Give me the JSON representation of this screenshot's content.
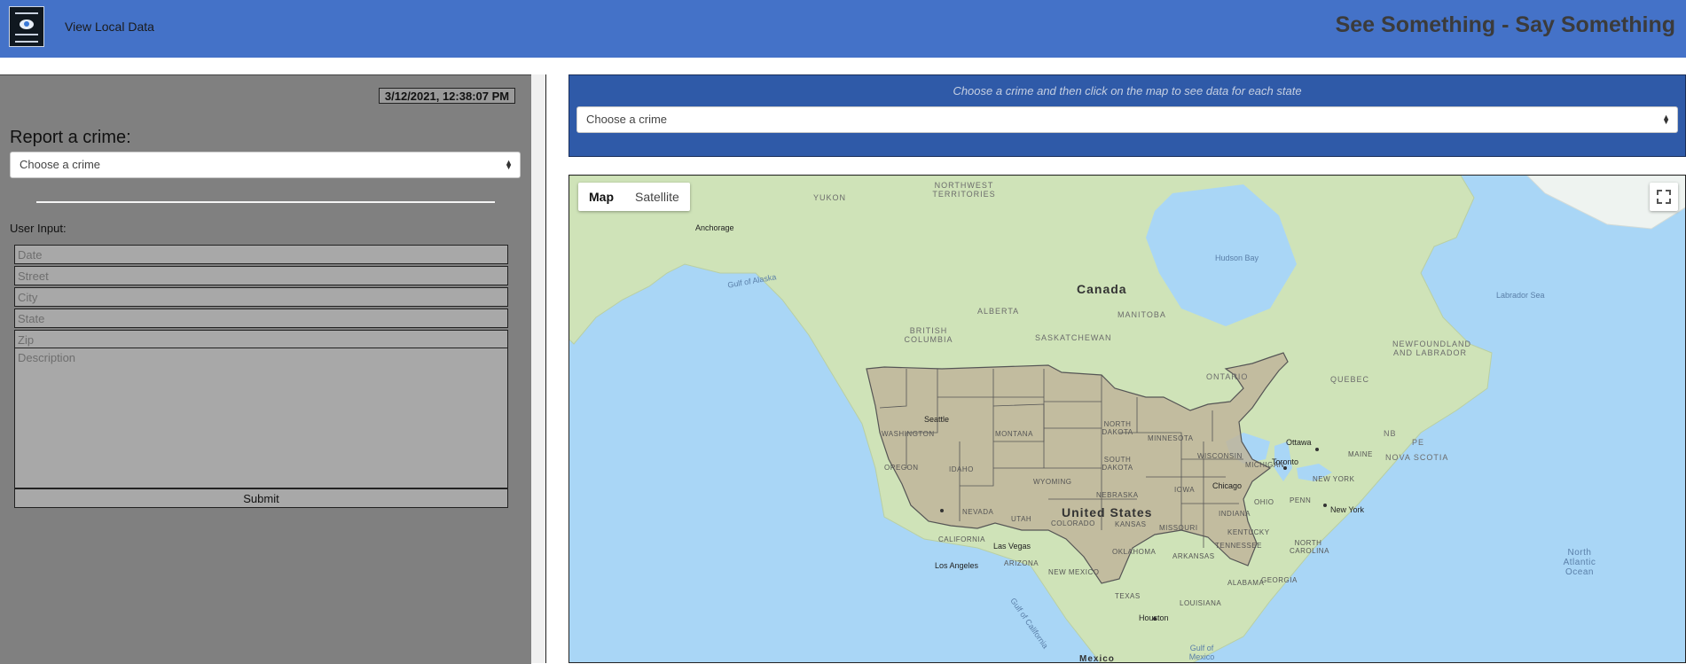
{
  "navbar": {
    "link_view_local": "View Local Data",
    "brand": "See Something - Say Something"
  },
  "report": {
    "timestamp": "3/12/2021, 12:38:07 PM",
    "title": "Report a crime:",
    "crime_select": "Choose a crime",
    "user_input_label": "User Input:",
    "placeholders": {
      "date": "Date",
      "street": "Street",
      "city": "City",
      "state": "State",
      "zip": "Zip",
      "description": "Description"
    },
    "submit_label": "Submit"
  },
  "filter": {
    "hint": "Choose a crime and then click on the map to see data for each state",
    "crime_select": "Choose a crime"
  },
  "map": {
    "type_buttons": [
      "Map",
      "Satellite"
    ],
    "active_type": "Map",
    "labels": {
      "countries": [
        "Canada",
        "United States",
        "Mexico"
      ],
      "provinces": [
        "YUKON",
        "NORTHWEST TERRITORIES",
        "ALBERTA",
        "BRITISH COLUMBIA",
        "SASKATCHEWAN",
        "MANITOBA",
        "ONTARIO",
        "QUEBEC",
        "NEWFOUNDLAND AND LABRADOR",
        "NB",
        "PE",
        "NOVA SCOTIA"
      ],
      "states": [
        "WASHINGTON",
        "OREGON",
        "IDAHO",
        "MONTANA",
        "WYOMING",
        "NORTH DAKOTA",
        "SOUTH DAKOTA",
        "NEBRASKA",
        "MINNESOTA",
        "WISCONSIN",
        "MICHIGAN",
        "IOWA",
        "NEVADA",
        "UTAH",
        "COLORADO",
        "KANSAS",
        "MISSOURI",
        "CALIFORNIA",
        "ARIZONA",
        "NEW MEXICO",
        "OKLAHOMA",
        "TEXAS",
        "ARKANSAS",
        "LOUISIANA",
        "TENNESSEE",
        "KENTUCKY",
        "INDIANA",
        "OHIO",
        "PENN",
        "NEW YORK",
        "MAINE",
        "NORTH CAROLINA",
        "GEORGIA",
        "ALABAMA"
      ],
      "water": [
        "Gulf of Alaska",
        "Hudson Bay",
        "Labrador Sea",
        "North Atlantic Ocean",
        "Gulf of Mexico",
        "Gulf of California"
      ],
      "cities": [
        "Anchorage",
        "Seattle",
        "Ottawa",
        "Toronto",
        "New York",
        "Chicago",
        "Las Vegas",
        "Los Angeles",
        "Houston"
      ]
    },
    "colors": {
      "water": "#a9d6f6",
      "land": "#cfe3b8",
      "us_overlay": "#bfb59a"
    }
  }
}
